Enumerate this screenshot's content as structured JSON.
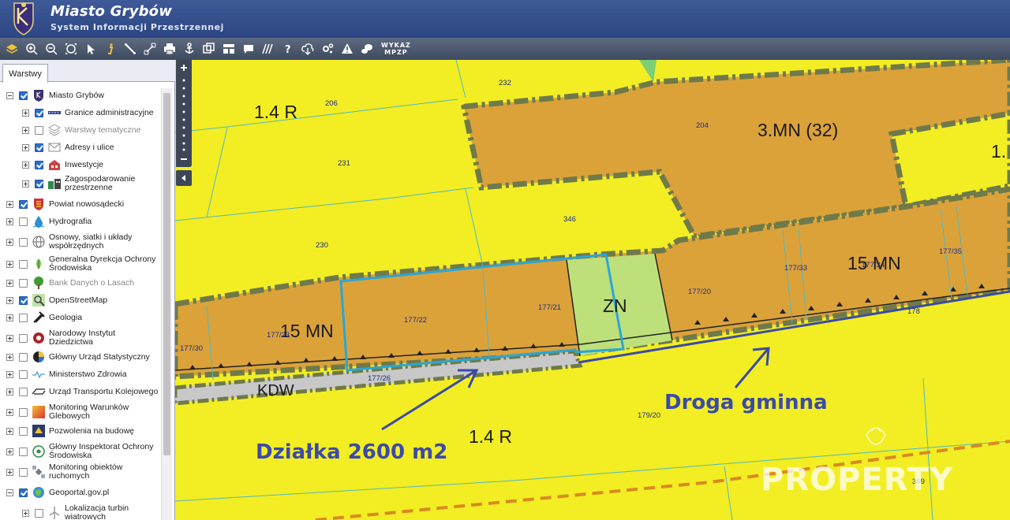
{
  "header": {
    "title": "Miasto Grybów",
    "subtitle": "System Informacji Przestrzennej"
  },
  "toolbar": {
    "icons": [
      "layers-icon",
      "zoom-in-icon",
      "zoom-out-icon",
      "zoom-extent-icon",
      "pointer-icon",
      "info-icon",
      "measure-line-icon",
      "measure-link-icon",
      "print-icon",
      "anchor-icon",
      "copy-icon",
      "layout-icon",
      "comment-icon",
      "hatch-icon",
      "help-icon",
      "cloud-download-icon",
      "settings-icon",
      "warning-icon",
      "chat-icon"
    ],
    "wykaz_line1": "WYKAZ",
    "wykaz_line2": "MPZP"
  },
  "sidebar": {
    "tab_label": "Warstwy",
    "layers": [
      {
        "label": "Miasto Grybów",
        "checked": true,
        "level": 0,
        "expanded": true,
        "icon": "crest-icon"
      },
      {
        "label": "Granice administracyjne",
        "checked": true,
        "level": 1,
        "icon": "boundary-icon"
      },
      {
        "label": "Warstwy tematyczne",
        "checked": false,
        "level": 1,
        "muted": true,
        "icon": "stack-icon"
      },
      {
        "label": "Adresy i ulice",
        "checked": true,
        "level": 1,
        "icon": "envelope-icon"
      },
      {
        "label": "Inwestycje",
        "checked": true,
        "level": 1,
        "icon": "building-icon"
      },
      {
        "label": "Zagospodarowanie przestrzenne",
        "checked": true,
        "level": 1,
        "icon": "planning-icon"
      },
      {
        "label": "Powiat nowosądecki",
        "checked": true,
        "level": 0,
        "icon": "county-crest-icon"
      },
      {
        "label": "Hydrografia",
        "checked": false,
        "level": 0,
        "icon": "water-drop-icon"
      },
      {
        "label": "Osnowy, siatki i układy współrzędnych",
        "checked": false,
        "level": 0,
        "icon": "globe-icon"
      },
      {
        "label": "Generalna Dyrekcja Ochrony Środowiska",
        "checked": false,
        "level": 0,
        "icon": "leaf-icon"
      },
      {
        "label": "Bank Danych o Lasach",
        "checked": false,
        "level": 0,
        "muted": true,
        "icon": "tree-icon"
      },
      {
        "label": "OpenStreetMap",
        "checked": true,
        "level": 0,
        "icon": "osm-icon"
      },
      {
        "label": "Geologia",
        "checked": false,
        "level": 0,
        "icon": "hammer-icon"
      },
      {
        "label": "Narodowy Instytut Dziedzictwa",
        "checked": false,
        "level": 0,
        "icon": "heritage-icon"
      },
      {
        "label": "Główny Urząd Statystyczny",
        "checked": false,
        "level": 0,
        "icon": "statistics-icon"
      },
      {
        "label": "Ministerstwo Zdrowia",
        "checked": false,
        "level": 0,
        "icon": "pulse-icon"
      },
      {
        "label": "Urząd Transportu Kolejowego",
        "checked": false,
        "level": 0,
        "icon": "rail-icon"
      },
      {
        "label": "Monitoring Warunków Glebowych",
        "checked": false,
        "level": 0,
        "icon": "soil-icon"
      },
      {
        "label": "Pozwolenia na budowę",
        "checked": false,
        "level": 0,
        "icon": "permit-icon"
      },
      {
        "label": "Główny Inspektorat Ochrony Środowiska",
        "checked": false,
        "level": 0,
        "icon": "gios-icon"
      },
      {
        "label": "Monitoring obiektów ruchomych",
        "checked": false,
        "level": 0,
        "icon": "satellite-icon"
      },
      {
        "label": "Geoportal.gov.pl",
        "checked": true,
        "level": 0,
        "expanded": true,
        "icon": "geoportal-icon"
      },
      {
        "label": "Lokalizacja turbin wiatrowych",
        "checked": false,
        "level": 1,
        "icon": "wind-turbine-icon"
      }
    ]
  },
  "map": {
    "zones": [
      "1.4 R",
      "3.MN (32)",
      "1.",
      "15 MN",
      "15 MN",
      "ZN",
      "KDW",
      "1.4 R"
    ],
    "parcels": [
      "206",
      "232",
      "204",
      "231",
      "346",
      "230",
      "177/22",
      "177/21",
      "177/20",
      "177/33",
      "177/34",
      "177/35",
      "177/30",
      "177/23",
      "177/26",
      "178",
      "179/20",
      "369"
    ],
    "annotations": {
      "road": "Droga gminna",
      "plot": "Działka 2600 m2"
    },
    "watermark": "PROPERTY",
    "colors": {
      "agri_yellow": "#f2ee23",
      "residential_orange": "#dba23a",
      "green_zone": "#bde07a",
      "road_gray": "#c8c8c8",
      "plot_outline": "#2aa6d8",
      "arrow_blue": "#3b4aa8",
      "parcel_line": "#52b8c0"
    }
  }
}
